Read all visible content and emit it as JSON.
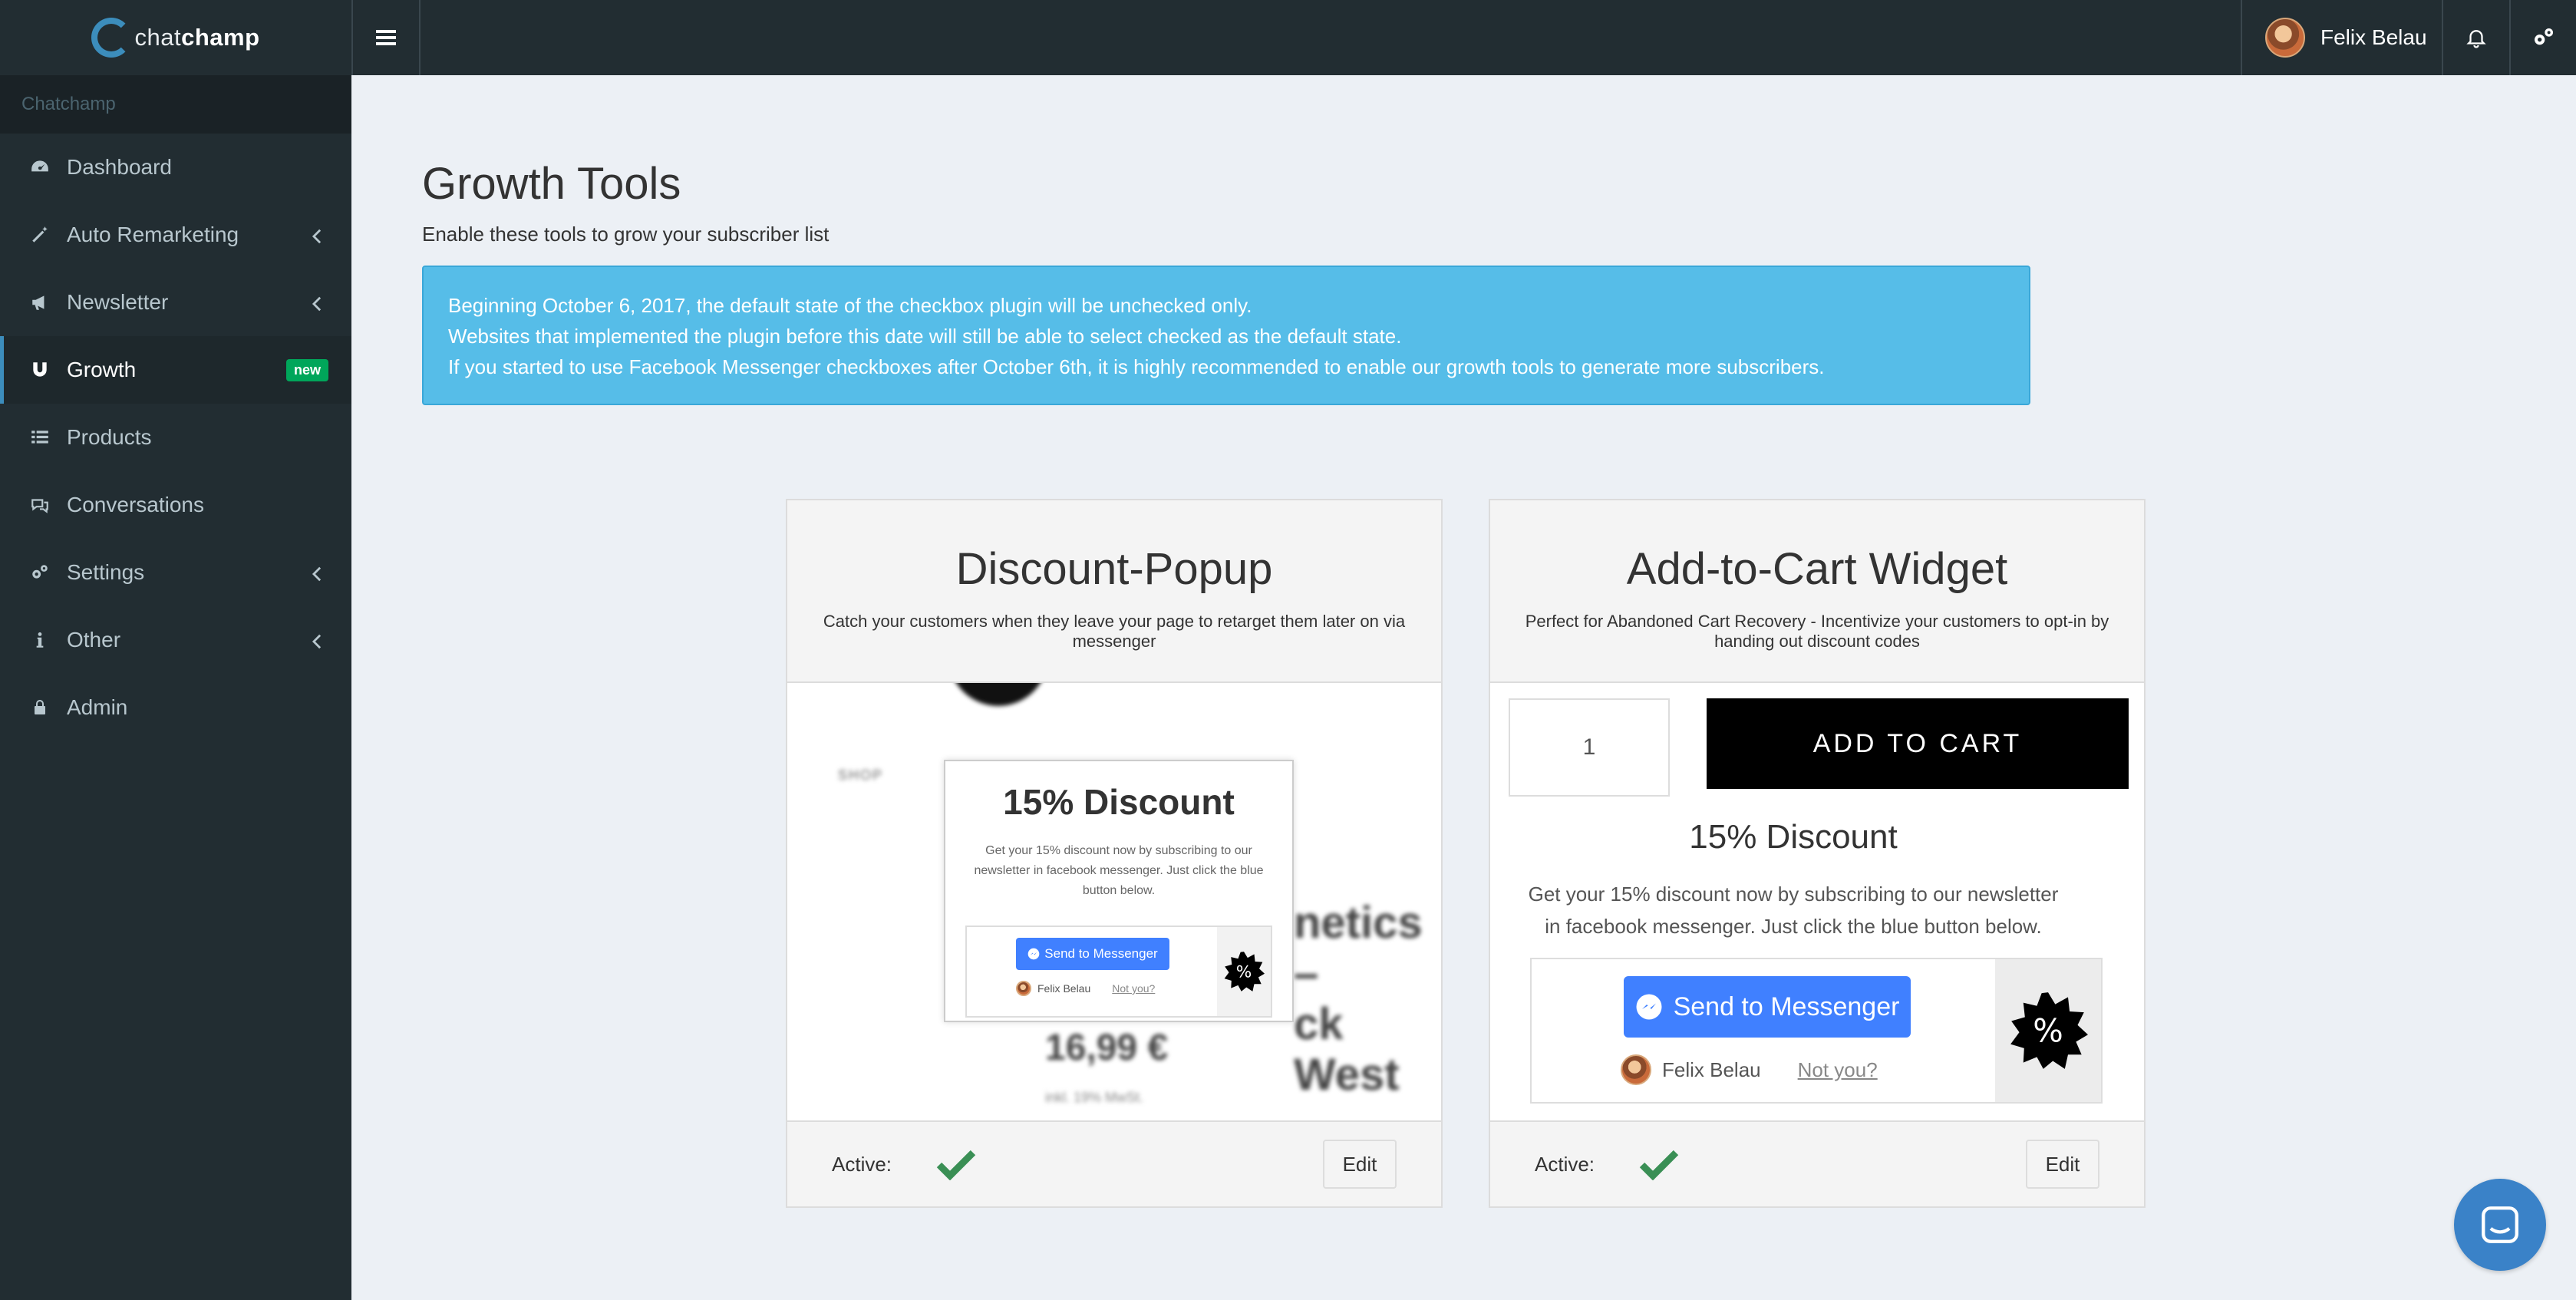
{
  "header": {
    "logo_prefix": "chat",
    "logo_brand": "champ",
    "user_name": "Felix Belau"
  },
  "sidebar": {
    "section_label": "Chatchamp",
    "items": [
      {
        "label": "Dashboard",
        "icon": "dashboard-icon"
      },
      {
        "label": "Auto Remarketing",
        "icon": "magic-wand-icon",
        "has_submenu": true
      },
      {
        "label": "Newsletter",
        "icon": "bullhorn-icon",
        "has_submenu": true
      },
      {
        "label": "Growth",
        "icon": "magnet-icon",
        "active": true,
        "badge": "new"
      },
      {
        "label": "Products",
        "icon": "list-icon"
      },
      {
        "label": "Conversations",
        "icon": "comments-icon"
      },
      {
        "label": "Settings",
        "icon": "gears-icon",
        "has_submenu": true
      },
      {
        "label": "Other",
        "icon": "info-icon",
        "has_submenu": true
      },
      {
        "label": "Admin",
        "icon": "lock-icon"
      }
    ]
  },
  "page": {
    "title": "Growth Tools",
    "subtitle": "Enable these tools to grow your subscriber list",
    "callout": [
      "Beginning October 6, 2017, the default state of the checkbox plugin will be unchecked only.",
      "Websites that implemented the plugin before this date will still be able to select checked as the default state.",
      "If you started to use Facebook Messenger checkboxes after October 6th, it is highly recommended to enable our growth tools to generate more subscribers."
    ]
  },
  "cards": [
    {
      "title": "Discount-Popup",
      "description": "Catch your customers when they leave your page to retarget them later on via messenger",
      "preview": {
        "popup_title": "15% Discount",
        "popup_text": "Get your 15% discount now by subscribing to our newsletter in facebook messenger. Just click the blue button below.",
        "button_label": "Send to Messenger",
        "user_name": "Felix Belau",
        "not_you": "Not you?",
        "bg_nav": "SHOP",
        "bg_title_line1": "netics –",
        "bg_title_line2": "ck West",
        "bg_price": "16,99 €",
        "bg_small": "inkl. 19% MwSt."
      },
      "active_label": "Active:",
      "active": true,
      "edit_label": "Edit"
    },
    {
      "title": "Add-to-Cart Widget",
      "description": "Perfect for Abandoned Cart Recovery - Incentivize your customers to opt-in by handing out discount codes",
      "preview": {
        "quantity": "1",
        "add_to_cart": "ADD TO CART",
        "discount_title": "15% Discount",
        "discount_text": "Get your 15% discount now by subscribing to our newsletter in facebook messenger. Just click the blue button below.",
        "button_label": "Send to Messenger",
        "user_name": "Felix Belau",
        "not_you": "Not you?"
      },
      "active_label": "Active:",
      "active": true,
      "edit_label": "Edit"
    }
  ],
  "colors": {
    "sidebar_bg": "#222d32",
    "content_bg": "#ecf0f5",
    "callout_bg": "#56bde8",
    "badge_green": "#00a65a",
    "check_green": "#3a8f55",
    "messenger_blue": "#4080ff"
  }
}
